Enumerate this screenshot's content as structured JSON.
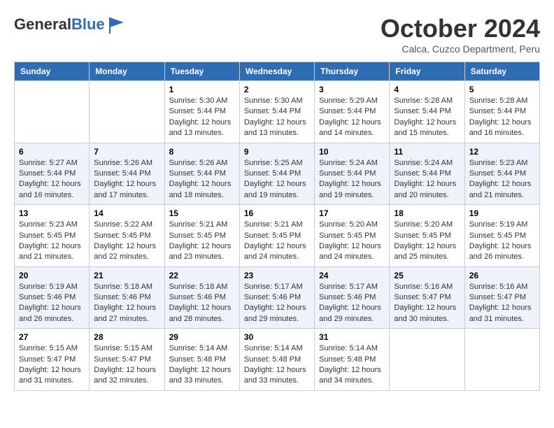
{
  "header": {
    "logo_general": "General",
    "logo_blue": "Blue",
    "month_title": "October 2024",
    "subtitle": "Calca, Cuzco Department, Peru"
  },
  "days_of_week": [
    "Sunday",
    "Monday",
    "Tuesday",
    "Wednesday",
    "Thursday",
    "Friday",
    "Saturday"
  ],
  "weeks": [
    [
      {
        "day": "",
        "info": ""
      },
      {
        "day": "",
        "info": ""
      },
      {
        "day": "1",
        "sunrise": "5:30 AM",
        "sunset": "5:44 PM",
        "daylight": "12 hours and 13 minutes."
      },
      {
        "day": "2",
        "sunrise": "5:30 AM",
        "sunset": "5:44 PM",
        "daylight": "12 hours and 13 minutes."
      },
      {
        "day": "3",
        "sunrise": "5:29 AM",
        "sunset": "5:44 PM",
        "daylight": "12 hours and 14 minutes."
      },
      {
        "day": "4",
        "sunrise": "5:28 AM",
        "sunset": "5:44 PM",
        "daylight": "12 hours and 15 minutes."
      },
      {
        "day": "5",
        "sunrise": "5:28 AM",
        "sunset": "5:44 PM",
        "daylight": "12 hours and 16 minutes."
      }
    ],
    [
      {
        "day": "6",
        "sunrise": "5:27 AM",
        "sunset": "5:44 PM",
        "daylight": "12 hours and 16 minutes."
      },
      {
        "day": "7",
        "sunrise": "5:26 AM",
        "sunset": "5:44 PM",
        "daylight": "12 hours and 17 minutes."
      },
      {
        "day": "8",
        "sunrise": "5:26 AM",
        "sunset": "5:44 PM",
        "daylight": "12 hours and 18 minutes."
      },
      {
        "day": "9",
        "sunrise": "5:25 AM",
        "sunset": "5:44 PM",
        "daylight": "12 hours and 19 minutes."
      },
      {
        "day": "10",
        "sunrise": "5:24 AM",
        "sunset": "5:44 PM",
        "daylight": "12 hours and 19 minutes."
      },
      {
        "day": "11",
        "sunrise": "5:24 AM",
        "sunset": "5:44 PM",
        "daylight": "12 hours and 20 minutes."
      },
      {
        "day": "12",
        "sunrise": "5:23 AM",
        "sunset": "5:44 PM",
        "daylight": "12 hours and 21 minutes."
      }
    ],
    [
      {
        "day": "13",
        "sunrise": "5:23 AM",
        "sunset": "5:45 PM",
        "daylight": "12 hours and 21 minutes."
      },
      {
        "day": "14",
        "sunrise": "5:22 AM",
        "sunset": "5:45 PM",
        "daylight": "12 hours and 22 minutes."
      },
      {
        "day": "15",
        "sunrise": "5:21 AM",
        "sunset": "5:45 PM",
        "daylight": "12 hours and 23 minutes."
      },
      {
        "day": "16",
        "sunrise": "5:21 AM",
        "sunset": "5:45 PM",
        "daylight": "12 hours and 24 minutes."
      },
      {
        "day": "17",
        "sunrise": "5:20 AM",
        "sunset": "5:45 PM",
        "daylight": "12 hours and 24 minutes."
      },
      {
        "day": "18",
        "sunrise": "5:20 AM",
        "sunset": "5:45 PM",
        "daylight": "12 hours and 25 minutes."
      },
      {
        "day": "19",
        "sunrise": "5:19 AM",
        "sunset": "5:45 PM",
        "daylight": "12 hours and 26 minutes."
      }
    ],
    [
      {
        "day": "20",
        "sunrise": "5:19 AM",
        "sunset": "5:46 PM",
        "daylight": "12 hours and 26 minutes."
      },
      {
        "day": "21",
        "sunrise": "5:18 AM",
        "sunset": "5:46 PM",
        "daylight": "12 hours and 27 minutes."
      },
      {
        "day": "22",
        "sunrise": "5:18 AM",
        "sunset": "5:46 PM",
        "daylight": "12 hours and 28 minutes."
      },
      {
        "day": "23",
        "sunrise": "5:17 AM",
        "sunset": "5:46 PM",
        "daylight": "12 hours and 29 minutes."
      },
      {
        "day": "24",
        "sunrise": "5:17 AM",
        "sunset": "5:46 PM",
        "daylight": "12 hours and 29 minutes."
      },
      {
        "day": "25",
        "sunrise": "5:16 AM",
        "sunset": "5:47 PM",
        "daylight": "12 hours and 30 minutes."
      },
      {
        "day": "26",
        "sunrise": "5:16 AM",
        "sunset": "5:47 PM",
        "daylight": "12 hours and 31 minutes."
      }
    ],
    [
      {
        "day": "27",
        "sunrise": "5:15 AM",
        "sunset": "5:47 PM",
        "daylight": "12 hours and 31 minutes."
      },
      {
        "day": "28",
        "sunrise": "5:15 AM",
        "sunset": "5:47 PM",
        "daylight": "12 hours and 32 minutes."
      },
      {
        "day": "29",
        "sunrise": "5:14 AM",
        "sunset": "5:48 PM",
        "daylight": "12 hours and 33 minutes."
      },
      {
        "day": "30",
        "sunrise": "5:14 AM",
        "sunset": "5:48 PM",
        "daylight": "12 hours and 33 minutes."
      },
      {
        "day": "31",
        "sunrise": "5:14 AM",
        "sunset": "5:48 PM",
        "daylight": "12 hours and 34 minutes."
      },
      {
        "day": "",
        "info": ""
      },
      {
        "day": "",
        "info": ""
      }
    ]
  ],
  "labels": {
    "sunrise": "Sunrise:",
    "sunset": "Sunset:",
    "daylight": "Daylight:"
  }
}
